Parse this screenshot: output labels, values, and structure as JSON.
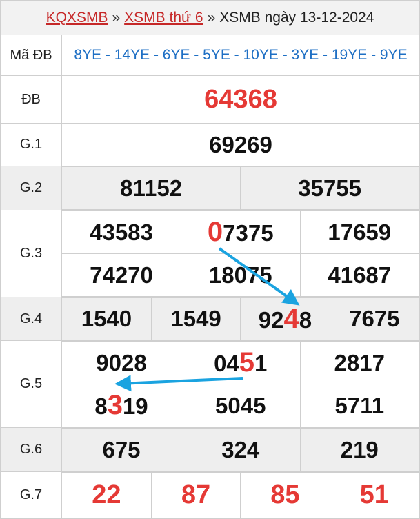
{
  "breadcrumb": {
    "link1": "KQXSMB",
    "sep1": "»",
    "link2": "XSMB thứ 6",
    "sep2": "»",
    "current": "XSMB ngày 13-12-2024"
  },
  "madb": {
    "label": "Mã ĐB",
    "values": "8YE - 14YE - 6YE - 5YE - 10YE - 3YE - 19YE - 9YE"
  },
  "prizes": {
    "db": {
      "label": "ĐB",
      "value": "64368"
    },
    "g1": {
      "label": "G.1",
      "value": "69269"
    },
    "g2": {
      "label": "G.2",
      "values": [
        "81152",
        "35755"
      ]
    },
    "g3": {
      "label": "G.3",
      "row1": [
        "43583",
        {
          "hl": "0",
          "rest": "7375"
        },
        "17659"
      ],
      "row2": [
        "74270",
        "18075",
        "41687"
      ]
    },
    "g4": {
      "label": "G.4",
      "values": [
        "1540",
        "1549",
        {
          "pre": "92",
          "hl": "4",
          "post": "8"
        },
        "7675"
      ]
    },
    "g5": {
      "label": "G.5",
      "row1": [
        "9028",
        {
          "pre": "04",
          "hl": "5",
          "post": "1"
        },
        "2817"
      ],
      "row2": [
        {
          "pre": "8",
          "hl": "3",
          "post": "19"
        },
        "5045",
        "5711"
      ]
    },
    "g6": {
      "label": "G.6",
      "values": [
        "675",
        "324",
        "219"
      ]
    },
    "g7": {
      "label": "G.7",
      "values": [
        "22",
        "87",
        "85",
        "51"
      ]
    }
  },
  "colors": {
    "link_red": "#c62828",
    "number_red": "#e53935",
    "madb_blue": "#1e6fc4",
    "arrow_blue": "#1aa3e0"
  }
}
